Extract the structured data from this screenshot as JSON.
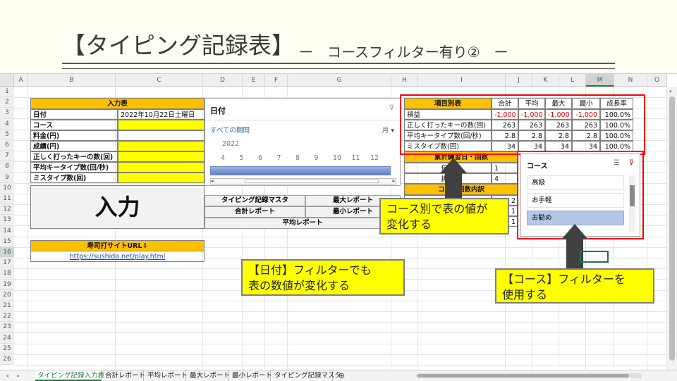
{
  "slide": {
    "title": "【タイピング記録表】",
    "subtitle": "ー　コースフィルター有り②　ー"
  },
  "sheet": {
    "columns": [
      "A",
      "B",
      "C",
      "D",
      "E",
      "F",
      "G",
      "H",
      "I",
      "J",
      "K",
      "L",
      "M",
      "N",
      "O"
    ],
    "selected_column": "M",
    "selected_row": "16",
    "rows": [
      "1",
      "2",
      "3",
      "4",
      "5",
      "6",
      "7",
      "8",
      "9",
      "10",
      "11",
      "12",
      "13",
      "14",
      "15",
      "16",
      "17",
      "18",
      "19",
      "20",
      "21",
      "22",
      "23",
      "24",
      "25",
      "26"
    ]
  },
  "input_table": {
    "header": "入力表",
    "rows": [
      {
        "label": "日付",
        "value": "2022年10月22日土曜日"
      },
      {
        "label": "コース",
        "value": ""
      },
      {
        "label": "料金(円)",
        "value": ""
      },
      {
        "label": "成績(円)",
        "value": ""
      },
      {
        "label": "正しく打ったキーの数(回)",
        "value": ""
      },
      {
        "label": "平均キータイプ数(回/秒)",
        "value": ""
      },
      {
        "label": "ミスタイプ数(回)",
        "value": ""
      }
    ],
    "input_button": "入力"
  },
  "url_box": {
    "header": "寿司打サイトURL⇩",
    "url": "https://sushida.net/play.html"
  },
  "date_slicer": {
    "title": "日付",
    "period": "すべての期間",
    "unit": "月",
    "year": "2022",
    "months": [
      "4",
      "5",
      "6",
      "7",
      "8",
      "9",
      "10",
      "11",
      "12"
    ]
  },
  "nav_buttons": {
    "master": "タイピング記録マスタ",
    "max": "最大レポート",
    "total": "合計レポート",
    "min": "最小レポート",
    "average": "平均レポート"
  },
  "summary_table": {
    "headers": [
      "項目別表",
      "合計",
      "平均",
      "最大",
      "最小",
      "成長率"
    ],
    "rows": [
      {
        "label": "損益",
        "values": [
          "-1,000",
          "-1,000",
          "-1,000",
          "-1,000",
          "100.0%"
        ],
        "negative": true
      },
      {
        "label": "正しく打ったキーの数(回)",
        "values": [
          "263",
          "263",
          "263",
          "263",
          "100.0%"
        ],
        "negative": false
      },
      {
        "label": "平均キータイプ数(回/秒)",
        "values": [
          "2.8",
          "2.8",
          "2.8",
          "2.8",
          "100.0%"
        ],
        "negative": false
      },
      {
        "label": "ミスタイプ数(回)",
        "values": [
          "34",
          "34",
          "34",
          "34",
          "100.0%"
        ],
        "negative": false
      }
    ],
    "sub_header_1": "累計練習日・回数",
    "row_practice_label": "何日",
    "row_practice_value": "1",
    "row_challenge_label": "挑戦",
    "row_challenge_value": "4",
    "sub_header_2": "コース回数内訳",
    "breakdown_values": [
      "2",
      "1",
      "1"
    ]
  },
  "course_slicer": {
    "title": "コース",
    "items": [
      "高級",
      "お手軽",
      "お勧め"
    ],
    "selected": "お勧め"
  },
  "callouts": {
    "course_table": "コース別で表の値が\n変化する",
    "date_filter": "【日付】フィルターでも\n表の数値が変化する",
    "course_filter": "【コース】フィルターを\n使用する"
  },
  "sheet_tabs": [
    "タイピング記録入力表",
    "合計レポート",
    "平均レポート",
    "最大レポート",
    "最小レポート",
    "タイピング記録マスタ"
  ],
  "active_tab": "タイピング記録入力表",
  "colors": {
    "header_orange": "#ffc000",
    "input_yellow": "#ffff00",
    "callout_yellow": "#ffff00",
    "highlight_red": "#ff0000",
    "slicer_selected": "#b4c7e7",
    "excel_green": "#217346"
  }
}
